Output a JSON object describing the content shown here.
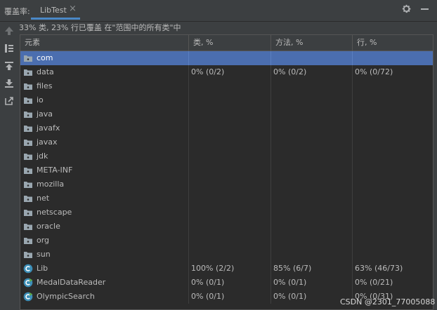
{
  "header": {
    "title": "覆盖率:",
    "tab_label": "LibTest",
    "tab_close": "×",
    "settings_icon": "gear-icon",
    "minimize_icon": "minimize-icon"
  },
  "summary": "33% 类, 23% 行已覆盖 在\"范围中的所有类\"中",
  "toolbar": [
    "arrow-up-icon",
    "flatten-packages-icon",
    "import-icon",
    "export-icon",
    "jump-to-source-icon"
  ],
  "table": {
    "columns": [
      "元素",
      "类, %",
      "方法, %",
      "行, %"
    ],
    "rows": [
      {
        "name": "com",
        "kind": "package",
        "cls": "",
        "method": "",
        "line": "",
        "selected": true
      },
      {
        "name": "data",
        "kind": "package",
        "cls": "0% (0/2)",
        "method": "0% (0/2)",
        "line": "0% (0/72)"
      },
      {
        "name": "files",
        "kind": "package",
        "cls": "",
        "method": "",
        "line": ""
      },
      {
        "name": "io",
        "kind": "package",
        "cls": "",
        "method": "",
        "line": ""
      },
      {
        "name": "java",
        "kind": "package",
        "cls": "",
        "method": "",
        "line": ""
      },
      {
        "name": "javafx",
        "kind": "package",
        "cls": "",
        "method": "",
        "line": ""
      },
      {
        "name": "javax",
        "kind": "package",
        "cls": "",
        "method": "",
        "line": ""
      },
      {
        "name": "jdk",
        "kind": "package",
        "cls": "",
        "method": "",
        "line": ""
      },
      {
        "name": "META-INF",
        "kind": "package",
        "cls": "",
        "method": "",
        "line": ""
      },
      {
        "name": "mozilla",
        "kind": "package",
        "cls": "",
        "method": "",
        "line": ""
      },
      {
        "name": "net",
        "kind": "package",
        "cls": "",
        "method": "",
        "line": ""
      },
      {
        "name": "netscape",
        "kind": "package",
        "cls": "",
        "method": "",
        "line": ""
      },
      {
        "name": "oracle",
        "kind": "package",
        "cls": "",
        "method": "",
        "line": ""
      },
      {
        "name": "org",
        "kind": "package",
        "cls": "",
        "method": "",
        "line": ""
      },
      {
        "name": "sun",
        "kind": "package",
        "cls": "",
        "method": "",
        "line": ""
      },
      {
        "name": "Lib",
        "kind": "class",
        "cls": "100% (2/2)",
        "method": "85% (6/7)",
        "line": "63% (46/73)"
      },
      {
        "name": "MedalDataReader",
        "kind": "runnable-class",
        "cls": "0% (0/1)",
        "method": "0% (0/1)",
        "line": "0% (0/21)"
      },
      {
        "name": "OlympicSearch",
        "kind": "runnable-class",
        "cls": "0% (0/1)",
        "method": "0% (0/1)",
        "line": "0% (0/31)"
      }
    ]
  },
  "watermark": "CSDN @2301_77005088",
  "colors": {
    "background": "#3c3f41",
    "table_bg": "#2b2b2b",
    "selection": "#4b6eaf",
    "tab_underline": "#4a88c7",
    "folder": "#9aa7b0",
    "class_icon": "#3d8fb8",
    "run_badge": "#5faa4d"
  }
}
